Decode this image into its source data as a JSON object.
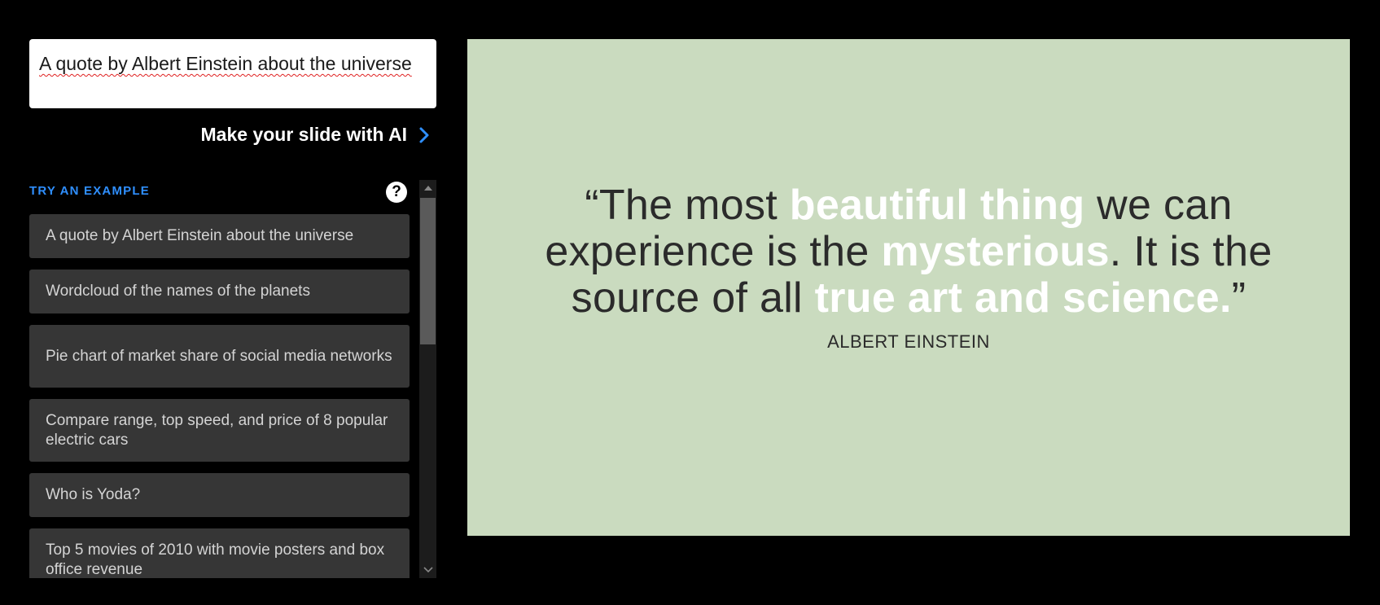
{
  "prompt": {
    "value": "A quote by Albert Einstein about the universe"
  },
  "make_button": {
    "label": "Make your slide with AI"
  },
  "examples_section": {
    "heading": "TRY AN EXAMPLE",
    "help_icon": "?",
    "items": [
      "A quote by Albert Einstein about the universe",
      "Wordcloud of the names of the planets",
      "Pie chart of market share of social media networks",
      "Compare range, top speed, and price of 8 popular electric cars",
      "Who is Yoda?",
      "Top 5 movies of 2010 with movie posters and box office revenue"
    ]
  },
  "slide": {
    "background": "#cadbbf",
    "quote_parts": [
      {
        "text": "“The most ",
        "highlight": false
      },
      {
        "text": "beautiful thing",
        "highlight": true
      },
      {
        "text": " we can experience is the ",
        "highlight": false
      },
      {
        "text": "mysterious",
        "highlight": true
      },
      {
        "text": ". It is the source of all ",
        "highlight": false
      },
      {
        "text": "true art and science.",
        "highlight": true
      },
      {
        "text": "”",
        "highlight": false
      }
    ],
    "author": "ALBERT EINSTEIN"
  },
  "icons": {
    "make_button": "chevron-right-icon",
    "help": "question-circle-icon",
    "scroll_up": "triangle-up-icon",
    "scroll_down": "chevron-down-icon"
  },
  "colors": {
    "accent": "#2f8fff",
    "example_bg": "#363636",
    "highlight_text": "#ffffff"
  }
}
